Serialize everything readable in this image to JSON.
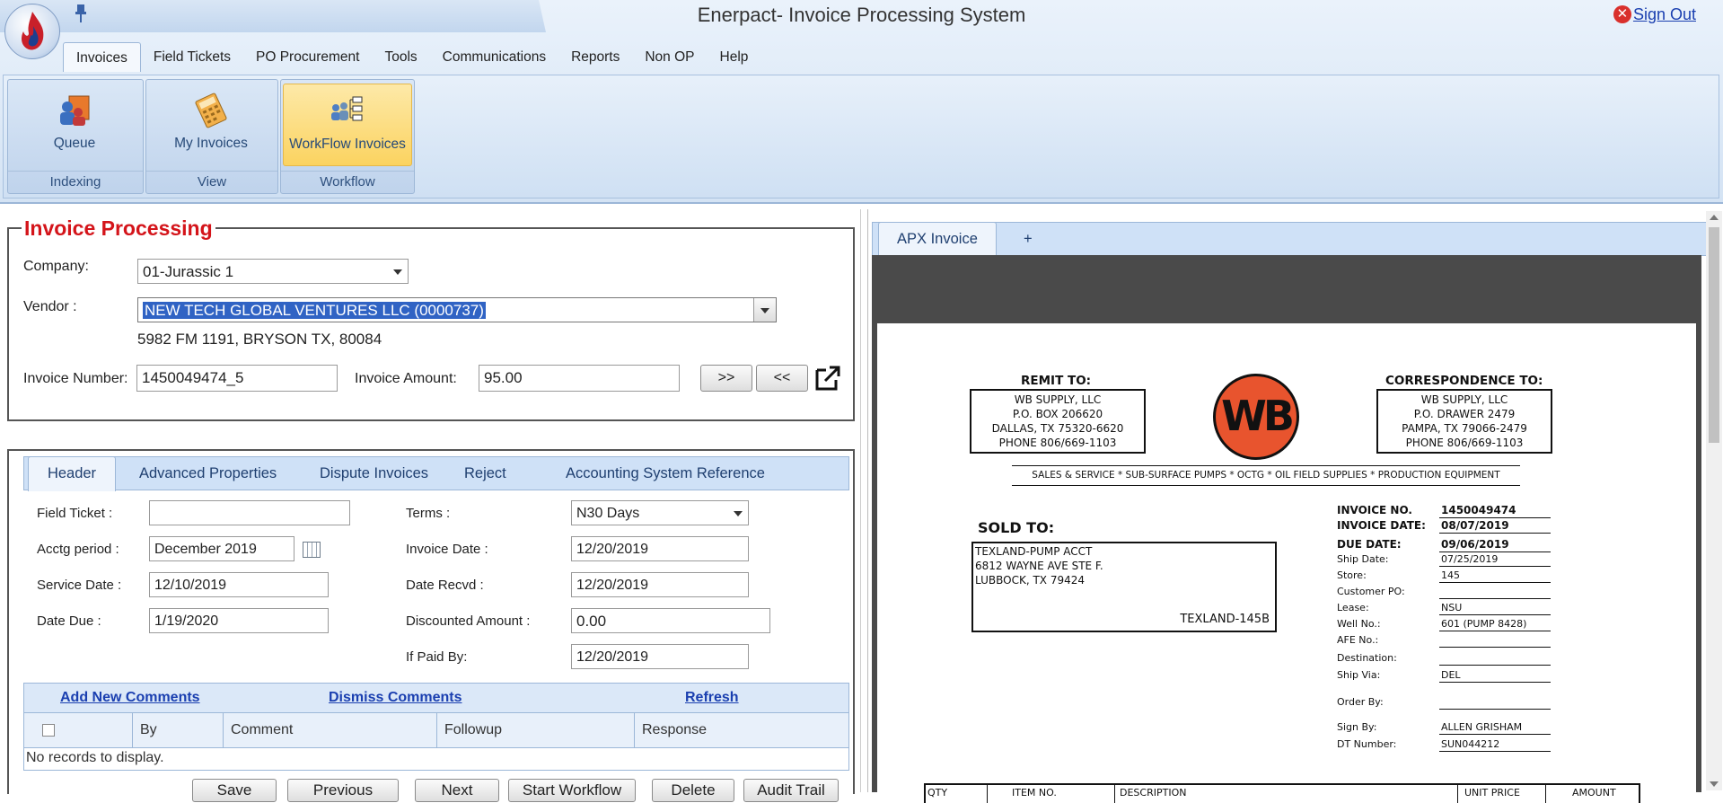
{
  "app": {
    "title": "Enerpact- Invoice Processing System",
    "sign_out": "Sign Out"
  },
  "menu": [
    "Invoices",
    "Field Tickets",
    "PO Procurement",
    "Tools",
    "Communications",
    "Reports",
    "Non OP",
    "Help"
  ],
  "ribbon": {
    "groups": [
      {
        "label": "Indexing",
        "button": "Queue"
      },
      {
        "label": "View",
        "button": "My Invoices"
      },
      {
        "label": "Workflow",
        "button": "WorkFlow Invoices"
      }
    ]
  },
  "invoice_processing": {
    "title": "Invoice Processing",
    "company_label": "Company:",
    "company_value": "01-Jurassic 1",
    "vendor_label": "Vendor :",
    "vendor_value": "NEW TECH GLOBAL VENTURES LLC (0000737)",
    "vendor_address": "5982 FM 1191, BRYSON TX, 80084",
    "invoice_number_label": "Invoice Number:",
    "invoice_number_value": "1450049474_5",
    "invoice_amount_label": "Invoice Amount:",
    "invoice_amount_value": "95.00",
    "next_btn": ">>",
    "prev_btn": "<<"
  },
  "tabs": [
    "Header",
    "Advanced Properties",
    "Dispute Invoices",
    "Reject",
    "Accounting System Reference"
  ],
  "header_form": {
    "field_ticket_label": "Field Ticket :",
    "field_ticket_value": "",
    "acctg_period_label": "Acctg period :",
    "acctg_period_value": "December 2019",
    "service_date_label": "Service Date :",
    "service_date_value": "12/10/2019",
    "date_due_label": "Date Due :",
    "date_due_value": "1/19/2020",
    "terms_label": "Terms :",
    "terms_value": "N30 Days",
    "invoice_date_label": "Invoice Date :",
    "invoice_date_value": "12/20/2019",
    "date_recvd_label": "Date Recvd :",
    "date_recvd_value": "12/20/2019",
    "discounted_amount_label": "Discounted Amount :",
    "discounted_amount_value": "0.00",
    "if_paid_by_label": "If Paid By:",
    "if_paid_by_value": "12/20/2019"
  },
  "comments": {
    "add": "Add New Comments",
    "dismiss": "Dismiss Comments",
    "refresh": "Refresh",
    "columns": [
      "By",
      "Comment",
      "Followup",
      "Response"
    ],
    "empty": "No records to display."
  },
  "bottom_buttons": [
    "Save",
    "Previous",
    "Next",
    "Start Workflow",
    "Delete",
    "Audit Trail"
  ],
  "viewer": {
    "tab": "APX Invoice",
    "add_tab": "+"
  },
  "invoice_doc": {
    "remit_to_title": "REMIT TO:",
    "remit_to": [
      "WB SUPPLY, LLC",
      "P.O. BOX 206620",
      "DALLAS, TX 75320-6620",
      "PHONE 806/669-1103"
    ],
    "logo_text": "WB",
    "correspondence_title": "CORRESPONDENCE  TO:",
    "correspondence": [
      "WB SUPPLY, LLC",
      "P.O. DRAWER 2479",
      "PAMPA, TX 79066-2479",
      "PHONE 806/669-1103"
    ],
    "tagline": "SALES & SERVICE * SUB-SURFACE PUMPS * OCTG * OIL FIELD SUPPLIES * PRODUCTION EQUIPMENT",
    "sold_to_title": "SOLD TO:",
    "sold_to": [
      "TEXLAND-PUMP ACCT",
      "6812 WAYNE AVE STE F.",
      "LUBBOCK, TX 79424"
    ],
    "sold_to_code": "TEXLAND-145B",
    "fields": [
      {
        "label": "INVOICE NO.",
        "value": "1450049474",
        "bold": true
      },
      {
        "label": "INVOICE DATE:",
        "value": "08/07/2019",
        "bold": true
      },
      {
        "label": "DUE DATE:",
        "value": "09/06/2019",
        "bold": true
      },
      {
        "label": "Ship Date:",
        "value": "07/25/2019",
        "bold": false
      },
      {
        "label": "Store:",
        "value": "145",
        "bold": false
      },
      {
        "label": "Customer PO:",
        "value": "",
        "bold": false
      },
      {
        "label": "Lease:",
        "value": "NSU",
        "bold": false
      },
      {
        "label": "Well No.:",
        "value": "601 (PUMP 8428)",
        "bold": false
      },
      {
        "label": "AFE No.:",
        "value": "",
        "bold": false
      },
      {
        "label": "Destination:",
        "value": "",
        "bold": false
      },
      {
        "label": "Ship Via:",
        "value": "DEL",
        "bold": false
      },
      {
        "label": "Order By:",
        "value": "",
        "bold": false
      },
      {
        "label": "Sign By:",
        "value": "ALLEN GRISHAM",
        "bold": false
      },
      {
        "label": "DT Number:",
        "value": "SUN044212",
        "bold": false
      }
    ],
    "table_headers": [
      "QTY",
      "ITEM NO.",
      "DESCRIPTION",
      "UNIT PRICE",
      "AMOUNT"
    ]
  }
}
